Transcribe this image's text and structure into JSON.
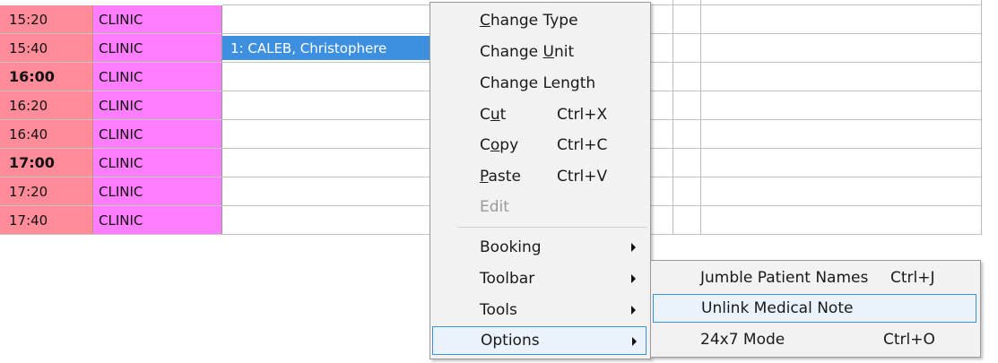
{
  "schedule": {
    "rows": [
      {
        "time": "15:20",
        "bold": false,
        "type": "CLINIC",
        "appointment": ""
      },
      {
        "time": "15:40",
        "bold": false,
        "type": "CLINIC",
        "appointment": "1: CALEB, Christophere"
      },
      {
        "time": "16:00",
        "bold": true,
        "type": "CLINIC",
        "appointment": ""
      },
      {
        "time": "16:20",
        "bold": false,
        "type": "CLINIC",
        "appointment": ""
      },
      {
        "time": "16:40",
        "bold": false,
        "type": "CLINIC",
        "appointment": ""
      },
      {
        "time": "17:00",
        "bold": true,
        "type": "CLINIC",
        "appointment": ""
      },
      {
        "time": "17:20",
        "bold": false,
        "type": "CLINIC",
        "appointment": ""
      },
      {
        "time": "17:40",
        "bold": false,
        "type": "CLINIC",
        "appointment": ""
      }
    ],
    "colors": {
      "time_column": "#ff8c98",
      "type_column": "#ff7dff",
      "appointment_highlight": "#3d8fe0"
    }
  },
  "context_menu": {
    "items": [
      {
        "id": "change-type",
        "pre": "",
        "ul": "C",
        "post": "hange Type",
        "shortcut": "",
        "submenu": false,
        "disabled": false
      },
      {
        "id": "change-unit",
        "pre": "Change ",
        "ul": "U",
        "post": "nit",
        "shortcut": "",
        "submenu": false,
        "disabled": false
      },
      {
        "id": "change-length",
        "pre": "Chan",
        "ul": "g",
        "post": "e Length",
        "shortcut": "",
        "submenu": false,
        "disabled": false
      },
      {
        "id": "cut",
        "pre": "C",
        "ul": "u",
        "post": "t",
        "shortcut": "Ctrl+X",
        "submenu": false,
        "disabled": false
      },
      {
        "id": "copy",
        "pre": "C",
        "ul": "o",
        "post": "py",
        "shortcut": "Ctrl+C",
        "submenu": false,
        "disabled": false
      },
      {
        "id": "paste",
        "pre": "",
        "ul": "P",
        "post": "aste",
        "shortcut": "Ctrl+V",
        "submenu": false,
        "disabled": false
      },
      {
        "id": "edit",
        "pre": "Edit",
        "ul": "",
        "post": "",
        "shortcut": "",
        "submenu": false,
        "disabled": true
      },
      {
        "id": "booking",
        "pre": "Booking",
        "ul": "",
        "post": "",
        "shortcut": "",
        "submenu": true,
        "disabled": false
      },
      {
        "id": "toolbar",
        "pre": "Toolbar",
        "ul": "",
        "post": "",
        "shortcut": "",
        "submenu": true,
        "disabled": false
      },
      {
        "id": "tools",
        "pre": "Tools",
        "ul": "",
        "post": "",
        "shortcut": "",
        "submenu": true,
        "disabled": false
      },
      {
        "id": "options",
        "pre": "Options",
        "ul": "",
        "post": "",
        "shortcut": "",
        "submenu": true,
        "disabled": false,
        "active": true
      }
    ]
  },
  "options_submenu": {
    "items": [
      {
        "id": "jumble-patient-names",
        "label": "Jumble Patient Names",
        "shortcut": "Ctrl+J"
      },
      {
        "id": "unlink-medical-note",
        "label": "Unlink Medical Note",
        "shortcut": "",
        "active": true
      },
      {
        "id": "24x7-mode",
        "label": "24x7 Mode",
        "shortcut": "Ctrl+O"
      }
    ]
  }
}
